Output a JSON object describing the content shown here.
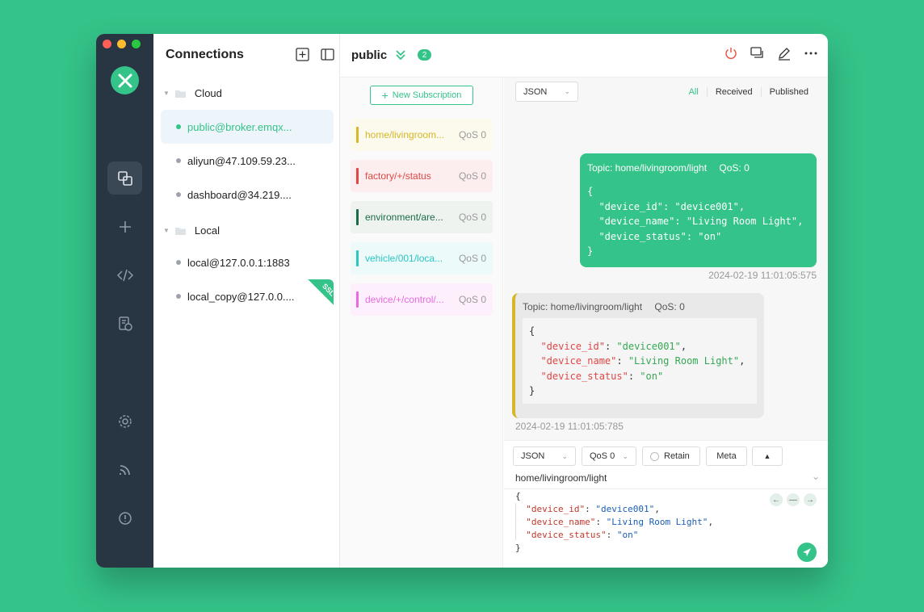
{
  "app": {
    "connections_title": "Connections",
    "groups": [
      {
        "name": "Cloud",
        "items": [
          {
            "label": "public@broker.emqx...",
            "active": true
          },
          {
            "label": "aliyun@47.109.59.23..."
          },
          {
            "label": "dashboard@34.219...."
          }
        ]
      },
      {
        "name": "Local",
        "items": [
          {
            "label": "local@127.0.0.1:1883"
          },
          {
            "label": "local_copy@127.0.0....",
            "badge": "SSL"
          }
        ]
      }
    ]
  },
  "topbar": {
    "name": "public",
    "sub_count": "2"
  },
  "subscriptions": {
    "new_label": "New Subscription",
    "items": [
      {
        "topic": "home/livingroom...",
        "qos": "QoS 0",
        "color": "#d4b72a",
        "bg": "#fcfaec"
      },
      {
        "topic": "factory/+/status",
        "qos": "QoS 0",
        "color": "#e04646",
        "bg": "#fceeee"
      },
      {
        "topic": "environment/are...",
        "qos": "QoS 0",
        "color": "#1b6b47",
        "bg": "#eef3f0"
      },
      {
        "topic": "vehicle/001/loca...",
        "qos": "QoS 0",
        "color": "#2bc7c4",
        "bg": "#ecfafa"
      },
      {
        "topic": "device/+/control/...",
        "qos": "QoS 0",
        "color": "#e76ae1",
        "bg": "#fdf0fc"
      }
    ]
  },
  "messages": {
    "format": "JSON",
    "filters": [
      "All",
      "Received",
      "Published"
    ],
    "published": {
      "topic": "Topic: home/livingroom/light",
      "qos": "QoS: 0",
      "time": "2024-02-19 11:01:05:575"
    },
    "received": {
      "topic": "Topic: home/livingroom/light",
      "qos": "QoS: 0",
      "time": "2024-02-19 11:01:05:785"
    },
    "payload": {
      "device_id_key": "\"device_id\"",
      "device_id_val": "\"device001\"",
      "device_name_key": "\"device_name\"",
      "device_name_val": "\"Living Room Light\"",
      "device_status_key": "\"device_status\"",
      "device_status_val": "\"on\""
    }
  },
  "composer": {
    "format": "JSON",
    "qos": "QoS 0",
    "retain": "Retain",
    "meta": "Meta",
    "topic": "home/livingroom/light"
  }
}
